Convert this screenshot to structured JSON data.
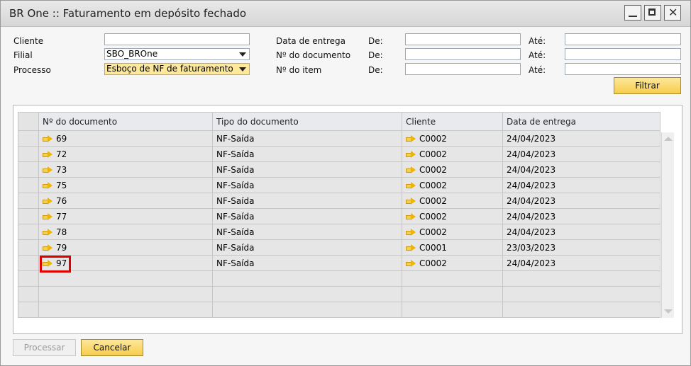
{
  "window": {
    "title": "BR One :: Faturamento em depósito fechado"
  },
  "filters": {
    "cliente_label": "Cliente",
    "cliente_value": "",
    "filial_label": "Filial",
    "filial_value": "SBO_BROne",
    "processo_label": "Processo",
    "processo_value": "Esboço de NF de faturamento",
    "data_entrega_label": "Data de entrega",
    "num_documento_label": "Nº do documento",
    "num_item_label": "Nº do item",
    "de_label": "De:",
    "ate_label": "Até:",
    "filtrar_label": "Filtrar"
  },
  "grid": {
    "columns": [
      "Nº do documento",
      "Tipo do documento",
      "Cliente",
      "Data de entrega"
    ],
    "rows": [
      {
        "doc": "69",
        "tipo": "NF-Saída",
        "cliente": "C0002",
        "data": "24/04/2023"
      },
      {
        "doc": "72",
        "tipo": "NF-Saída",
        "cliente": "C0002",
        "data": "24/04/2023"
      },
      {
        "doc": "73",
        "tipo": "NF-Saída",
        "cliente": "C0002",
        "data": "24/04/2023"
      },
      {
        "doc": "75",
        "tipo": "NF-Saída",
        "cliente": "C0002",
        "data": "24/04/2023"
      },
      {
        "doc": "76",
        "tipo": "NF-Saída",
        "cliente": "C0002",
        "data": "24/04/2023"
      },
      {
        "doc": "77",
        "tipo": "NF-Saída",
        "cliente": "C0002",
        "data": "24/04/2023"
      },
      {
        "doc": "78",
        "tipo": "NF-Saída",
        "cliente": "C0002",
        "data": "24/04/2023"
      },
      {
        "doc": "79",
        "tipo": "NF-Saída",
        "cliente": "C0001",
        "data": "23/03/2023"
      },
      {
        "doc": "97",
        "tipo": "NF-Saída",
        "cliente": "C0002",
        "data": "24/04/2023"
      }
    ],
    "highlight_color": "#e00000"
  },
  "footer": {
    "processar_label": "Processar",
    "cancelar_label": "Cancelar"
  }
}
